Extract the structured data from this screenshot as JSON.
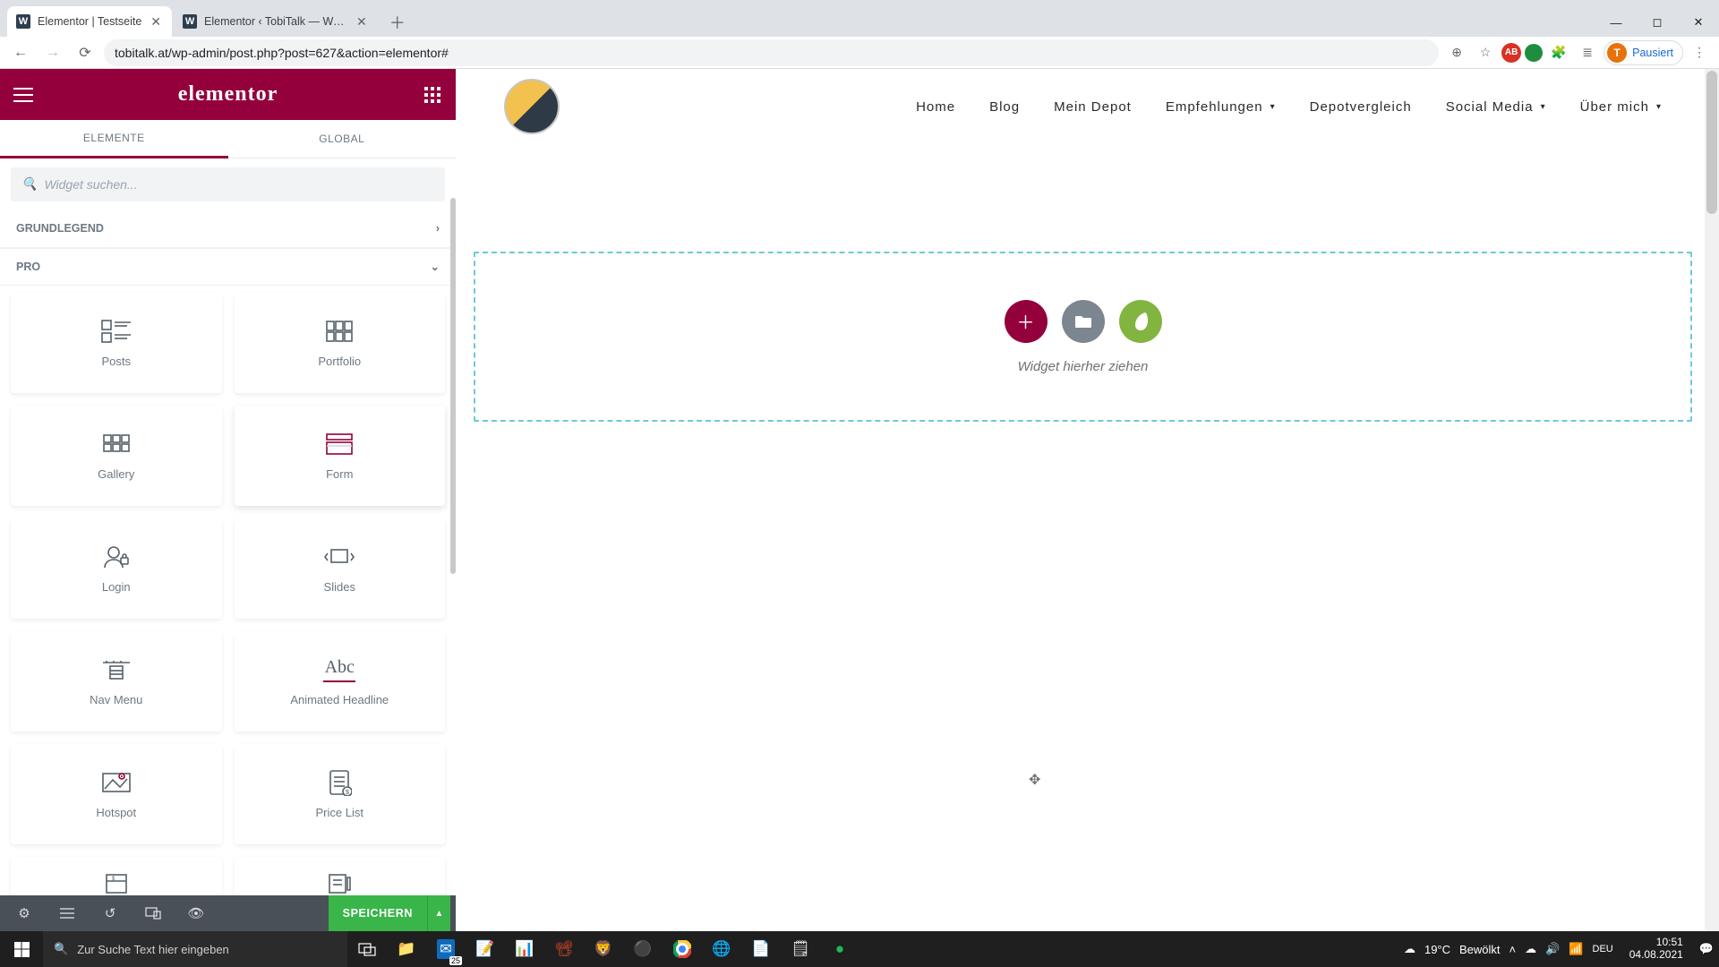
{
  "browser": {
    "tabs": [
      {
        "title": "Elementor | Testseite",
        "active": true
      },
      {
        "title": "Elementor ‹ TobiTalk — WordPre",
        "active": false
      }
    ],
    "url": "tobitalk.at/wp-admin/post.php?post=627&action=elementor#",
    "profile_letter": "T",
    "profile_state": "Pausiert"
  },
  "elementor": {
    "brand": "elementor",
    "tabs": {
      "elements": "ELEMENTE",
      "global": "GLOBAL"
    },
    "search_placeholder": "Widget suchen...",
    "categories": {
      "basic": "GRUNDLEGEND",
      "pro": "PRO"
    },
    "widgets": {
      "posts": "Posts",
      "portfolio": "Portfolio",
      "gallery": "Gallery",
      "form": "Form",
      "login": "Login",
      "slides": "Slides",
      "navmenu": "Nav Menu",
      "animhl": "Animated Headline",
      "hotspot": "Hotspot",
      "pricelist": "Price List",
      "animhl_abc": "Abc"
    },
    "save_label": "SPEICHERN",
    "dropzone_text": "Widget hierher ziehen"
  },
  "site": {
    "nav": {
      "home": "Home",
      "blog": "Blog",
      "depot": "Mein Depot",
      "empf": "Empfehlungen",
      "vergleich": "Depotvergleich",
      "social": "Social Media",
      "about": "Über mich"
    }
  },
  "taskbar": {
    "search_placeholder": "Zur Suche Text hier eingeben",
    "weather_temp": "19°C",
    "weather_cond": "Bewölkt",
    "time": "10:51",
    "date": "04.08.2021",
    "calendar_badge": "25"
  }
}
